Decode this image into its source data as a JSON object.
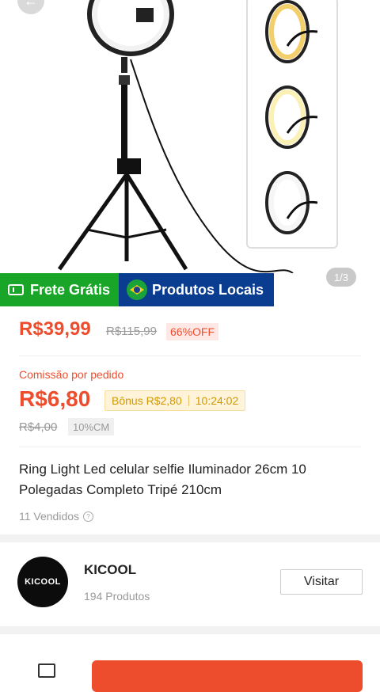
{
  "image": {
    "counter": "1/3"
  },
  "badges": {
    "free_shipping": "Frete Grátis",
    "local_products": "Produtos Locais"
  },
  "price": {
    "current": "R$39,99",
    "original": "R$115,99",
    "discount": "66%OFF"
  },
  "commission": {
    "label": "Comissão por pedido",
    "value": "R$6,80",
    "bonus": "Bônus R$2,80",
    "timer": "10:24:02",
    "original": "R$4,00",
    "rate": "10%CM"
  },
  "product": {
    "title": "Ring Light Led celular selfie Iluminador 26cm 10 Polegadas Completo Tripé 210cm",
    "sold": "11 Vendidos"
  },
  "shop": {
    "logo_text": "KICOOL",
    "name": "KICOOL",
    "products": "194 Produtos",
    "visit_label": "Visitar"
  },
  "colors": {
    "accent": "#ee4d2d",
    "free_badge": "#19a528",
    "local_badge": "#0a3d8f",
    "bonus_text": "#d19800"
  }
}
